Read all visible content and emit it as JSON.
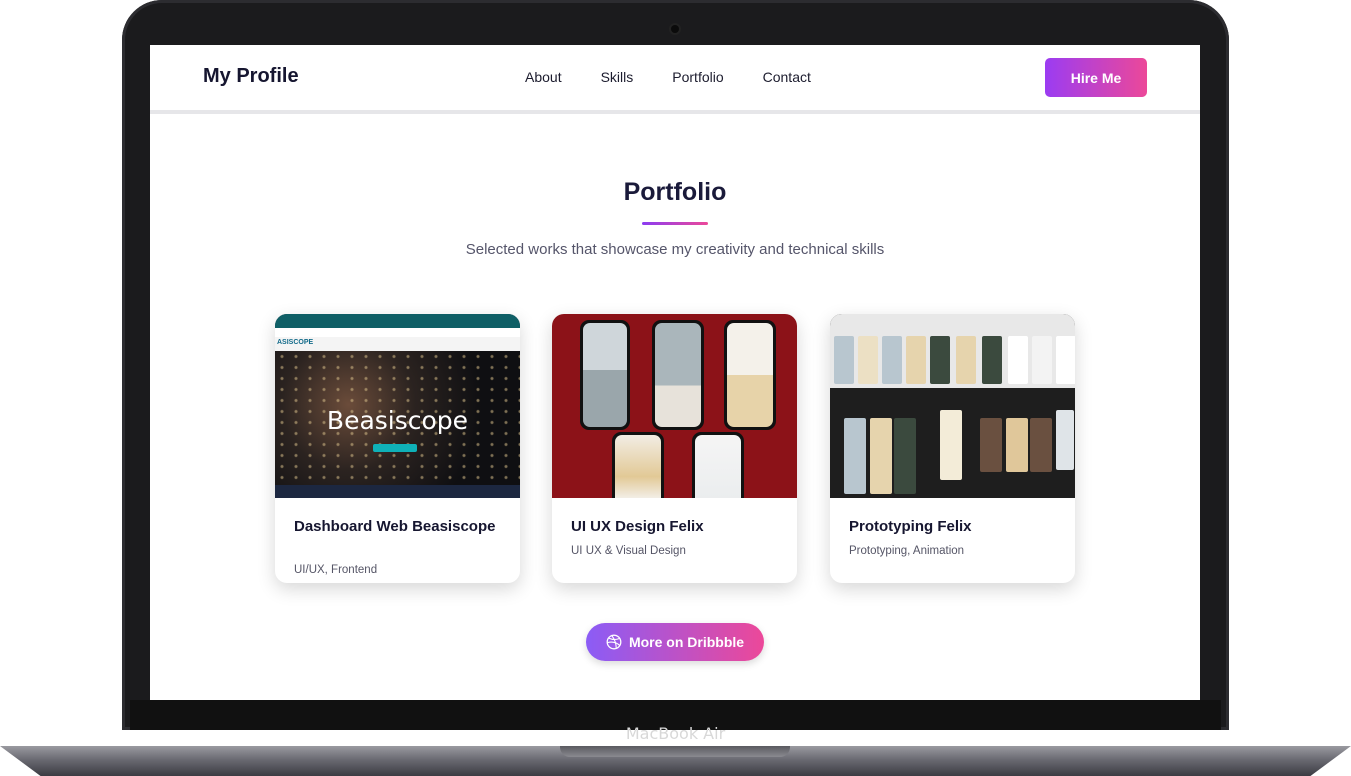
{
  "nav": {
    "logo": "My Profile",
    "links": [
      "About",
      "Skills",
      "Portfolio",
      "Contact"
    ],
    "hire_button": "Hire Me"
  },
  "section": {
    "title": "Portfolio",
    "subtitle": "Selected works that showcase my creativity and technical skills"
  },
  "projects": [
    {
      "title": "Dashboard Web Beasiscope",
      "tags": "UI/UX, Frontend",
      "image_brand": "Beasiscope",
      "image_logo": "ASISCOPE"
    },
    {
      "title": "UI UX Design Felix",
      "tags": "UI UX & Visual Design"
    },
    {
      "title": "Prototyping Felix",
      "tags": "Prototyping, Animation"
    }
  ],
  "more_button": "More on Dribbble",
  "device_label": "MacBook Air",
  "icons": {
    "dribbble": "dribbble-icon"
  },
  "colors": {
    "accent_start": "#9b3cf2",
    "accent_end": "#ec4899",
    "title": "#1a1a3a",
    "card2_bg": "#8c1218",
    "card3_bg": "#1e1e1e"
  }
}
